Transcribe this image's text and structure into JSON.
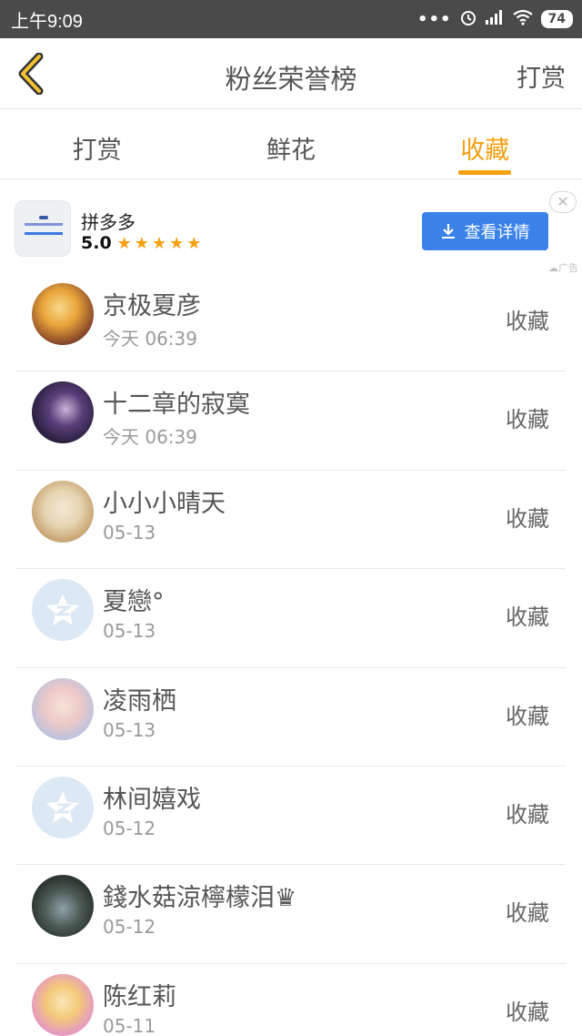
{
  "status_bar": {
    "time": "上午9:09",
    "battery": "74"
  },
  "header": {
    "title": "粉丝荣誉榜",
    "action_label": "打赏"
  },
  "tabs": [
    {
      "label": "打赏",
      "active": false
    },
    {
      "label": "鲜花",
      "active": false
    },
    {
      "label": "收藏",
      "active": true
    }
  ],
  "ad": {
    "app_name": "拼多多",
    "rating": "5.0",
    "stars": "★★★★★",
    "button_label": "查看详情",
    "close": "✕",
    "label": "广告"
  },
  "list": [
    {
      "name": "京极夏彦",
      "time": "今天 06:39",
      "action": "收藏",
      "avatar": "custom-orange"
    },
    {
      "name": "十二章的寂寞",
      "time": "今天 06:39",
      "action": "收藏",
      "avatar": "custom-purple"
    },
    {
      "name": "小小小晴天",
      "time": "05-13",
      "action": "收藏",
      "avatar": "custom-pale"
    },
    {
      "name": "夏戀°",
      "time": "05-13",
      "action": "收藏",
      "avatar": "default"
    },
    {
      "name": "凌雨栖",
      "time": "05-13",
      "action": "收藏",
      "avatar": "custom-pink"
    },
    {
      "name": "林间嬉戏",
      "time": "05-12",
      "action": "收藏",
      "avatar": "default"
    },
    {
      "name": "錢水菇涼檸檬泪♛",
      "time": "05-12",
      "action": "收藏",
      "avatar": "custom-dark"
    },
    {
      "name": "陈红莉",
      "time": "05-11",
      "action": "收藏",
      "avatar": "custom-gold"
    }
  ],
  "colors": {
    "accent": "#f5a011",
    "status_bar": "#4a4a4a",
    "ad_button": "#3a82e8"
  }
}
